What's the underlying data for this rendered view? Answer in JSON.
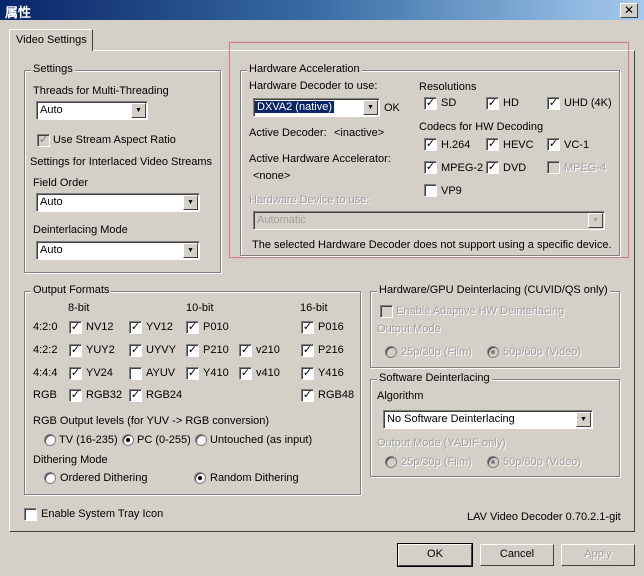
{
  "window": {
    "title": "属性",
    "close_label": "✕"
  },
  "tabs": [
    {
      "label": "Video Settings",
      "active": true
    }
  ],
  "settings": {
    "legend": "Settings",
    "threads_label": "Threads for Multi-Threading",
    "threads_value": "Auto",
    "stream_aspect_label": "Use Stream Aspect Ratio",
    "stream_aspect_checked": true,
    "interlaced_label": "Settings for Interlaced Video Streams",
    "field_order_label": "Field Order",
    "field_order_value": "Auto",
    "deint_mode_label": "Deinterlacing Mode",
    "deint_mode_value": "Auto"
  },
  "hw_accel": {
    "legend": "Hardware Acceleration",
    "decoder_label": "Hardware Decoder to use:",
    "decoder_value": "DXVA2 (native)",
    "decoder_status": "OK",
    "active_decoder_label": "Active Decoder:",
    "active_decoder_value": "<inactive>",
    "active_accel_label": "Active Hardware Accelerator:",
    "active_accel_value": "<none>",
    "device_label": "Hardware Device to use:",
    "device_value": "Automatic",
    "note": "The selected Hardware Decoder does not support using a specific device.",
    "resolutions_label": "Resolutions",
    "resolutions": [
      {
        "label": "SD",
        "checked": true
      },
      {
        "label": "HD",
        "checked": true
      },
      {
        "label": "UHD (4K)",
        "checked": true
      }
    ],
    "codecs_label": "Codecs for HW Decoding",
    "codecs": [
      {
        "label": "H.264",
        "checked": true,
        "disabled": false
      },
      {
        "label": "HEVC",
        "checked": true,
        "disabled": false
      },
      {
        "label": "VC-1",
        "checked": true,
        "disabled": false
      },
      {
        "label": "MPEG-2",
        "checked": true,
        "disabled": false
      },
      {
        "label": "DVD",
        "checked": true,
        "disabled": false
      },
      {
        "label": "MPEG-4",
        "checked": false,
        "disabled": true
      },
      {
        "label": "VP9",
        "checked": false,
        "disabled": false
      }
    ]
  },
  "output_formats": {
    "legend": "Output Formats",
    "col_headers": [
      "8-bit",
      "10-bit",
      "16-bit"
    ],
    "row_labels": [
      "4:2:0",
      "4:2:2",
      "4:4:4",
      "RGB"
    ],
    "rows": [
      [
        {
          "label": "NV12",
          "checked": true
        },
        {
          "label": "YV12",
          "checked": true
        },
        {
          "label": "P010",
          "checked": true
        },
        null,
        {
          "label": "P016",
          "checked": true
        }
      ],
      [
        {
          "label": "YUY2",
          "checked": true
        },
        {
          "label": "UYVY",
          "checked": true
        },
        {
          "label": "P210",
          "checked": true
        },
        {
          "label": "v210",
          "checked": true
        },
        {
          "label": "P216",
          "checked": true
        }
      ],
      [
        {
          "label": "YV24",
          "checked": true
        },
        {
          "label": "AYUV",
          "checked": false
        },
        {
          "label": "Y410",
          "checked": true
        },
        {
          "label": "v410",
          "checked": true
        },
        {
          "label": "Y416",
          "checked": true
        }
      ],
      [
        {
          "label": "RGB32",
          "checked": true
        },
        {
          "label": "RGB24",
          "checked": true
        },
        null,
        null,
        {
          "label": "RGB48",
          "checked": true
        }
      ]
    ],
    "rgb_levels_label": "RGB Output levels (for YUV -> RGB conversion)",
    "rgb_levels": [
      {
        "label": "TV (16-235)",
        "selected": false
      },
      {
        "label": "PC (0-255)",
        "selected": true
      },
      {
        "label": "Untouched (as input)",
        "selected": false
      }
    ],
    "dithering_label": "Dithering Mode",
    "dithering": [
      {
        "label": "Ordered Dithering",
        "selected": false
      },
      {
        "label": "Random Dithering",
        "selected": true
      }
    ]
  },
  "hw_deint": {
    "legend": "Hardware/GPU Deinterlacing (CUVID/QS only)",
    "enable_label": "Enable Adaptive HW Deinterlacing",
    "enable_checked": false,
    "output_mode_label": "Output Mode",
    "modes": [
      {
        "label": "25p/30p (Film)",
        "selected": false
      },
      {
        "label": "50p/60p (Video)",
        "selected": true
      }
    ]
  },
  "sw_deint": {
    "legend": "Software Deinterlacing",
    "algorithm_label": "Algorithm",
    "algorithm_value": "No Software Deinterlacing",
    "output_mode_label": "Output Mode (YADIF only)",
    "modes": [
      {
        "label": "25p/30p (Film)",
        "selected": false
      },
      {
        "label": "50p/60p (Video)",
        "selected": true
      }
    ]
  },
  "tray_label": "Enable System Tray Icon",
  "tray_checked": false,
  "version": "LAV Video Decoder 0.70.2.1-git",
  "buttons": {
    "ok": "OK",
    "cancel": "Cancel",
    "apply": "Apply"
  }
}
